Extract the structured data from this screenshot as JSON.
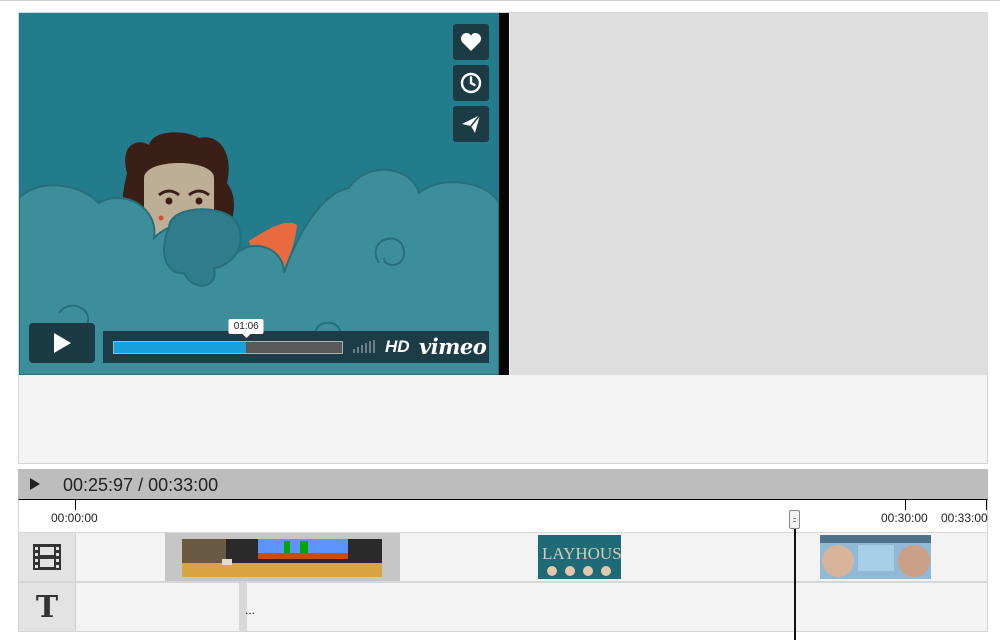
{
  "player": {
    "progress_tooltip": "01:06",
    "progress_fraction": 0.58,
    "hd_label": "HD",
    "brand": "vimeo",
    "side_buttons": [
      "heart-icon",
      "clock-icon",
      "paper-plane-icon"
    ],
    "play_icon": "play-icon",
    "colors": {
      "background": "#227c8b",
      "progress": "#19a1db",
      "controls": "#1c3d47"
    }
  },
  "timeline": {
    "play_icon": "play-icon",
    "time_display": "00:25:97 / 00:33:00",
    "ruler": {
      "labels": [
        "00:00:00",
        "00:30:00",
        "00:33:00"
      ]
    },
    "tracks": [
      {
        "name": "video",
        "icon": "film-icon"
      },
      {
        "name": "text",
        "icon": "text-icon",
        "icon_glyph": "T",
        "clip_text": "..."
      }
    ],
    "playhead_time": "00:25:97"
  }
}
